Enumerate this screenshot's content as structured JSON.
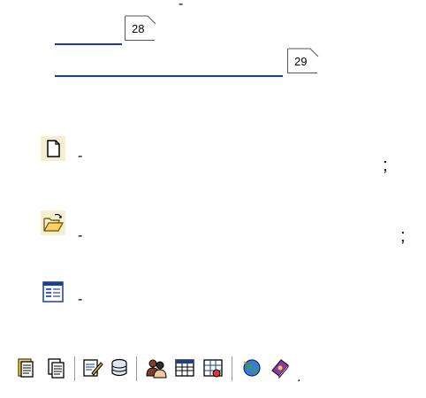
{
  "top_dash": "-",
  "footnotes": [
    {
      "number": "28"
    },
    {
      "number": "29"
    }
  ],
  "items": [
    {
      "icon": "new-document-icon",
      "dash": "-",
      "punct": ";"
    },
    {
      "icon": "open-folder-icon",
      "dash": "-",
      "punct": ";"
    },
    {
      "icon": "form-window-icon",
      "dash": "-",
      "punct": ""
    }
  ],
  "toolbar": {
    "icons": [
      "paste-document-icon",
      "copy-document-icon",
      "edit-pencil-icon",
      "database-cylinder-icon",
      "users-icon",
      "table-grid-icon",
      "calendar-icon",
      "globe-icon",
      "help-book-icon"
    ],
    "end_punct": "."
  },
  "colors": {
    "link": "#1a36c6",
    "icon_bg": "#f4efd0"
  }
}
